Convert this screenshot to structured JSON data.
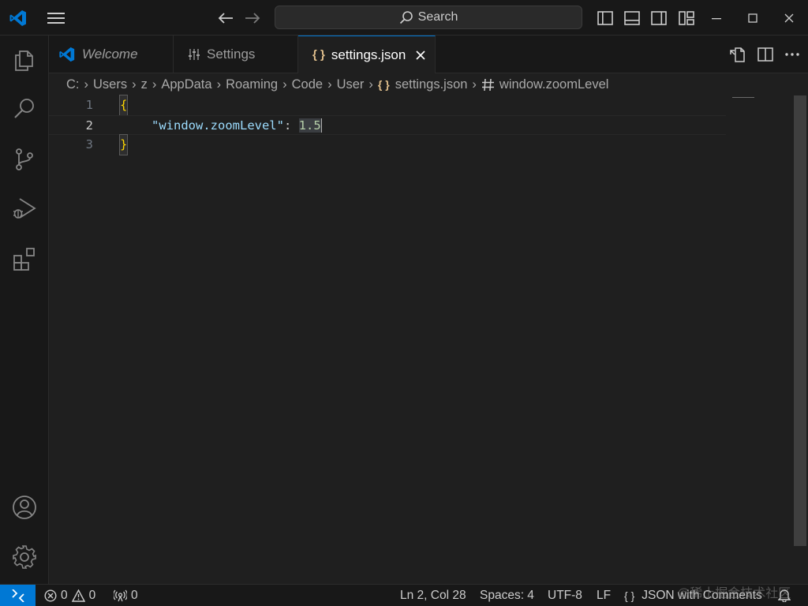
{
  "titlebar": {
    "search_label": "Search"
  },
  "tabs": [
    {
      "label": "Welcome"
    },
    {
      "label": "Settings"
    },
    {
      "label": "settings.json",
      "icon_text": "{ }"
    }
  ],
  "breadcrumb": [
    "C:",
    "Users",
    "z",
    "AppData",
    "Roaming",
    "Code",
    "User",
    "settings.json",
    "window.zoomLevel"
  ],
  "breadcrumb_json_icon": "{ }",
  "editor": {
    "line_numbers": [
      "1",
      "2",
      "3"
    ],
    "line1": "{",
    "line2_key": "\"window.zoomLevel\"",
    "line2_colon": ": ",
    "line2_value": "1.5",
    "line3": "}"
  },
  "statusbar": {
    "errors": "0",
    "warnings": "0",
    "ports": "0",
    "position": "Ln 2, Col 28",
    "spaces": "Spaces: 4",
    "encoding": "UTF-8",
    "eol": "LF",
    "language_icon": "{ }",
    "language": "JSON with Comments"
  },
  "watermark": "@稀土掘金技术社区",
  "colors": {
    "accent": "#0078d4",
    "json_icon": "#e2c08d",
    "string_key": "#9cdcfe",
    "number": "#b5cea8",
    "bracket": "#ffd700"
  }
}
